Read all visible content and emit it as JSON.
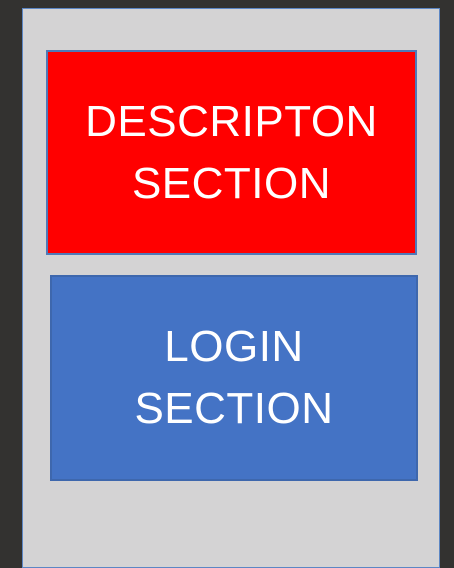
{
  "colors": {
    "background": "#333230",
    "frame": "#d4d3d4",
    "description": "#ff0000",
    "login": "#4473c5",
    "text": "#ffffff"
  },
  "description_section": {
    "line1": "DESCRIPTON",
    "line2": "SECTION"
  },
  "login_section": {
    "line1": "LOGIN",
    "line2": "SECTION"
  }
}
